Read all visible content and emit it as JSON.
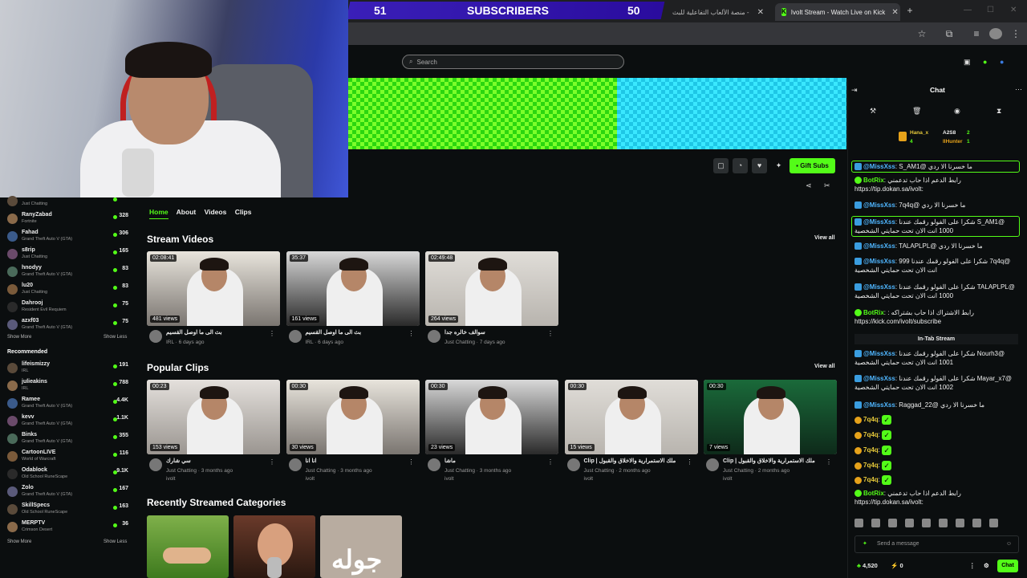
{
  "browser": {
    "tabs": [
      {
        "label": "منصة الألعاب التفاعلية للبث - Jawlah | جولة",
        "active": false
      },
      {
        "label": "Ivolt Stream - Watch Live on Kick",
        "active": true
      }
    ],
    "new_tab": "+"
  },
  "overlay": {
    "subs_left": "51",
    "subs_label": "SUBSCRIBERS",
    "subs_right": "50"
  },
  "header": {
    "search_placeholder": "Search"
  },
  "actions": {
    "gift_label": "Gift Subs"
  },
  "sidebar": {
    "following": [
      {
        "name": "",
        "game": "Just Chatting",
        "count": ""
      },
      {
        "name": "RanyZabad",
        "game": "Fortnite",
        "count": "328"
      },
      {
        "name": "Fahad",
        "game": "Grand Theft Auto V (GTA)",
        "count": "306"
      },
      {
        "name": "s8rip",
        "game": "Just Chatting",
        "count": "165"
      },
      {
        "name": "hnodyy",
        "game": "Grand Theft Auto V (GTA)",
        "count": "83"
      },
      {
        "name": "lu20",
        "game": "Just Chatting",
        "count": "83"
      },
      {
        "name": "Dahrooj",
        "game": "Resident Evil Requiem",
        "count": "75"
      },
      {
        "name": "azxf03",
        "game": "Grand Theft Auto V (GTA)",
        "count": "75"
      }
    ],
    "show_more": "Show More",
    "show_less": "Show Less",
    "recommended_label": "Recommended",
    "recommended": [
      {
        "name": "lifeismizzy",
        "game": "IRL",
        "count": "191"
      },
      {
        "name": "julieakins",
        "game": "IRL",
        "count": "788"
      },
      {
        "name": "Ramee",
        "game": "Grand Theft Auto V (GTA)",
        "count": "4.4K"
      },
      {
        "name": "kevv",
        "game": "Grand Theft Auto V (GTA)",
        "count": "1.1K"
      },
      {
        "name": "Binks",
        "game": "Grand Theft Auto V (GTA)",
        "count": "355"
      },
      {
        "name": "CartoonLIVE",
        "game": "World of Warcraft",
        "count": "116"
      },
      {
        "name": "Odablock",
        "game": "Old School RuneScape",
        "count": "9.1K"
      },
      {
        "name": "Zolo",
        "game": "Grand Theft Auto V (GTA)",
        "count": "167"
      },
      {
        "name": "SkillSpecs",
        "game": "Old School RuneScape",
        "count": "163"
      },
      {
        "name": "MERPTV",
        "game": "Crimson Desert",
        "count": "36"
      }
    ]
  },
  "main": {
    "nav": [
      "Home",
      "About",
      "Videos",
      "Clips"
    ],
    "stream_videos_title": "Stream Videos",
    "popular_clips_title": "Popular Clips",
    "categories_title": "Recently Streamed Categories",
    "view_all": "View all",
    "videos": [
      {
        "duration": "02:08:41",
        "views": "481 views",
        "title": "بث الى ما اوصل القسيم",
        "category": "IRL",
        "age": "6 days ago"
      },
      {
        "duration": "35:37",
        "views": "161 views",
        "title": "بث الى ما اوصل القسيم",
        "category": "IRL",
        "age": "6 days ago"
      },
      {
        "duration": "02:49:48",
        "views": "264 views",
        "title": "سوالف خالره جدا",
        "category": "Just Chatting",
        "age": "7 days ago"
      }
    ],
    "clips": [
      {
        "duration": "00:23",
        "views": "153 views",
        "title": "سي شارك",
        "category": "Just Chatting",
        "age": "3 months ago",
        "channel": "ivolt"
      },
      {
        "duration": "00:30",
        "views": "30 views",
        "title": "انا انا",
        "category": "Just Chatting",
        "age": "3 months ago",
        "channel": "ivolt"
      },
      {
        "duration": "00:30",
        "views": "23 views",
        "title": "ماشا",
        "category": "Just Chatting",
        "age": "3 months ago",
        "channel": "ivolt"
      },
      {
        "duration": "00:30",
        "views": "15 views",
        "title": "ملك الاستمرارية والاخلاق والقبول | Clip",
        "category": "Just Chatting",
        "age": "2 months ago",
        "channel": "ivolt"
      },
      {
        "duration": "00:30",
        "views": "7 views",
        "title": "ملك الاستمرارية والاخلاق والقبول | Clip",
        "category": "Just Chatting",
        "age": "2 months ago",
        "channel": "ivolt"
      }
    ],
    "category_text": "جوله"
  },
  "chat": {
    "title": "Chat",
    "leaders": [
      {
        "name": "Hana_x",
        "value": "4"
      },
      {
        "name": "A2S8",
        "value": "2"
      },
      {
        "name": "IlHunter",
        "value": "1"
      }
    ],
    "messages": [
      {
        "user": "@MissXss",
        "text": "ما خسرنا الا ردي @S_AM1",
        "color": "b",
        "hl": true
      },
      {
        "user": "BotRix",
        "text": "رابط الدعم اذا حاب تدعمني :https://tip.dokan.sa/ivolt",
        "color": "g",
        "hl": false
      },
      {
        "user": "@MissXss",
        "text": "ما خسرنا الا ردي @7q4q",
        "color": "b",
        "hl": false
      },
      {
        "user": "@MissXss",
        "text": "@S_AM1 شكرا على الفولو رقمك عندنا 1000 انت الان تحت حمايتي الشخصية",
        "color": "b",
        "hl": true
      },
      {
        "user": "@MissXss",
        "text": "ما خسرنا الا ردي @TALAPLPL",
        "color": "b",
        "hl": false
      },
      {
        "user": "@MissXss",
        "text": "@7q4q شكرا على الفولو رقمك عندنا 999 انت الان تحت حمايتي الشخصية",
        "color": "b",
        "hl": false
      },
      {
        "user": "@MissXss",
        "text": "@TALAPLPL شكرا على الفولو رقمك عندنا 1000 انت الان تحت حمايتي الشخصية",
        "color": "b",
        "hl": false
      },
      {
        "user": "BotRix",
        "text": "رابط الاشتراك اذا حاب بشتراكه : https://kick.com/ivolt/subscribe",
        "color": "g",
        "hl": false
      }
    ],
    "intab": "In-Tab Stream",
    "messages2": [
      {
        "user": "@MissXss",
        "text": "@Nourh3 شكرا على الفولو رقمك عندنا 1001 انت الان تحت حمايتي الشخصية",
        "color": "b"
      },
      {
        "user": "@MissXss",
        "text": "@Mayar_x7 شكرا على الفولو رقمك عندنا 1002 انت الان تحت حمايتي الشخصية",
        "color": "b"
      },
      {
        "user": "@MissXss",
        "text": "ما خسرنا الا ردي @Raggad_22",
        "color": "b"
      },
      {
        "user": "7q4q",
        "text": "",
        "color": "y"
      },
      {
        "user": "7q4q",
        "text": "",
        "color": "y"
      },
      {
        "user": "7q4q",
        "text": "",
        "color": "y"
      },
      {
        "user": "7q4q",
        "text": "",
        "color": "y"
      },
      {
        "user": "7q4q",
        "text": "",
        "color": "y"
      },
      {
        "user": "BotRix",
        "text": "رابط الدعم اذا حاب تدعمني :https://tip.dokan.sa/ivolt",
        "color": "g"
      }
    ],
    "input_placeholder": "Send a message",
    "points": "4,520",
    "zero": "0",
    "chat_button": "Chat"
  },
  "colors": {
    "accent": "#53fc18",
    "bg": "#0b0e0f",
    "sub_bar": "#2a0c9e"
  }
}
